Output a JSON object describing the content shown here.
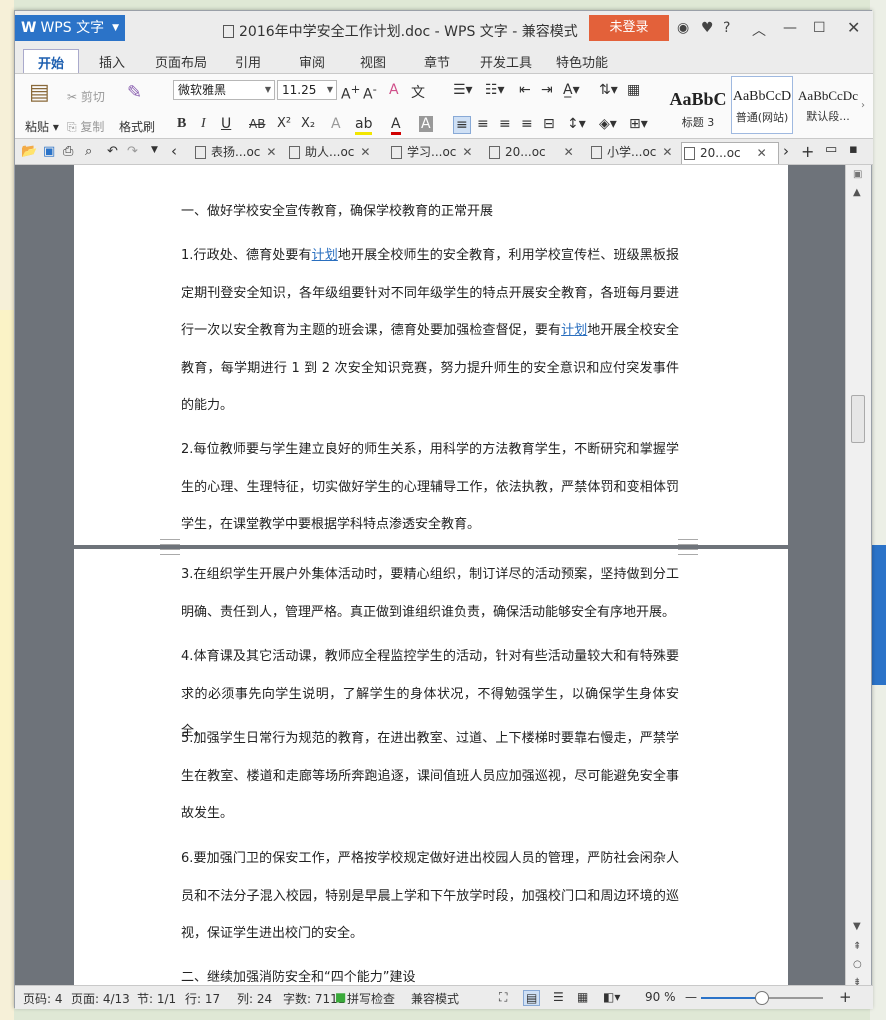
{
  "app": {
    "name": "WPS 文字",
    "title": "2016年中学安全工作计划.doc - WPS 文字 - 兼容模式",
    "login_label": "未登录",
    "help": "?"
  },
  "menu": [
    "开始",
    "插入",
    "页面布局",
    "引用",
    "审阅",
    "视图",
    "章节",
    "开发工具",
    "特色功能"
  ],
  "ribbon": {
    "paste": "粘贴",
    "cut": "剪切",
    "copy": "复制",
    "format_painter": "格式刷",
    "font_name": "微软雅黑",
    "font_size": "11.25",
    "bold": "B",
    "italic": "I",
    "underline": "U",
    "strike": "AB",
    "superscript": "X²",
    "subscript": "X₂",
    "styles": [
      {
        "preview": "AaBbC",
        "name": "标题 3"
      },
      {
        "preview": "AaBbCcD",
        "name": "普通(网站)"
      },
      {
        "preview": "AaBbCcDc",
        "name": "默认段..."
      }
    ]
  },
  "doc_tabs": [
    {
      "label": "表扬...oc",
      "active": false
    },
    {
      "label": "助人...oc",
      "active": false
    },
    {
      "label": "学习...oc",
      "active": false
    },
    {
      "label": "20...oc",
      "active": false
    },
    {
      "label": "小学...oc",
      "active": false
    },
    {
      "label": "20...oc",
      "active": true
    }
  ],
  "document": {
    "heading1": "一、做好学校安全宣传教育，确保学校教育的正常开展",
    "p1": {
      "a": "1.行政处、德育处要有",
      "link1": "计划",
      "b": "地开展全校师生的安全教育，利用学校宣传栏、班级黑板报定期刊登安全知识，各年级组要针对不同年级学生的特点开展安全教育，各班每月要进行一次以安全教育为主题的班会课，德育处要加强检查督促，要有",
      "link2": "计划",
      "c": "地开展全校安全教育，每学期进行 1 到 2 次安全知识竞赛，努力提升师生的安全意识和应付突发事件的能力。"
    },
    "p2": "2.每位教师要与学生建立良好的师生关系，用科学的方法教育学生，不断研究和掌握学生的心理、生理特征，切实做好学生的心理辅导工作，依法执教，严禁体罚和变相体罚学生，在课堂教学中要根据学科特点渗透安全教育。",
    "p3": "3.在组织学生开展户外集体活动时，要精心组织，制订详尽的活动预案，坚持做到分工明确、责任到人，管理严格。真正做到谁组织谁负责，确保活动能够安全有序地开展。",
    "p4": "4.体育课及其它活动课，教师应全程监控学生的活动，针对有些活动量较大和有特殊要求的必须事先向学生说明，了解学生的身体状况，不得勉强学生，以确保学生身体安全。",
    "p5": "5.加强学生日常行为规范的教育，在进出教室、过道、上下楼梯时要靠右慢走，严禁学生在教室、楼道和走廊等场所奔跑追逐，课间值班人员应加强巡视，尽可能避免安全事故发生。",
    "p6": "6.要加强门卫的保安工作，严格按学校规定做好进出校园人员的管理，严防社会闲杂人员和不法分子混入校园，特别是早晨上学和下午放学时段，加强校门口和周边环境的巡视，保证学生进出校门的安全。",
    "heading2": "二、继续加强消防安全和“四个能力”建设"
  },
  "status": {
    "page_no": "页码: 4",
    "pages": "页面: 4/13",
    "section": "节: 1/1",
    "line": "行: 17",
    "col": "列: 24",
    "words": "字数: 7111",
    "spell": "拼写检查",
    "mode": "兼容模式",
    "zoom": "90 %",
    "zoom_value": 0.5
  }
}
